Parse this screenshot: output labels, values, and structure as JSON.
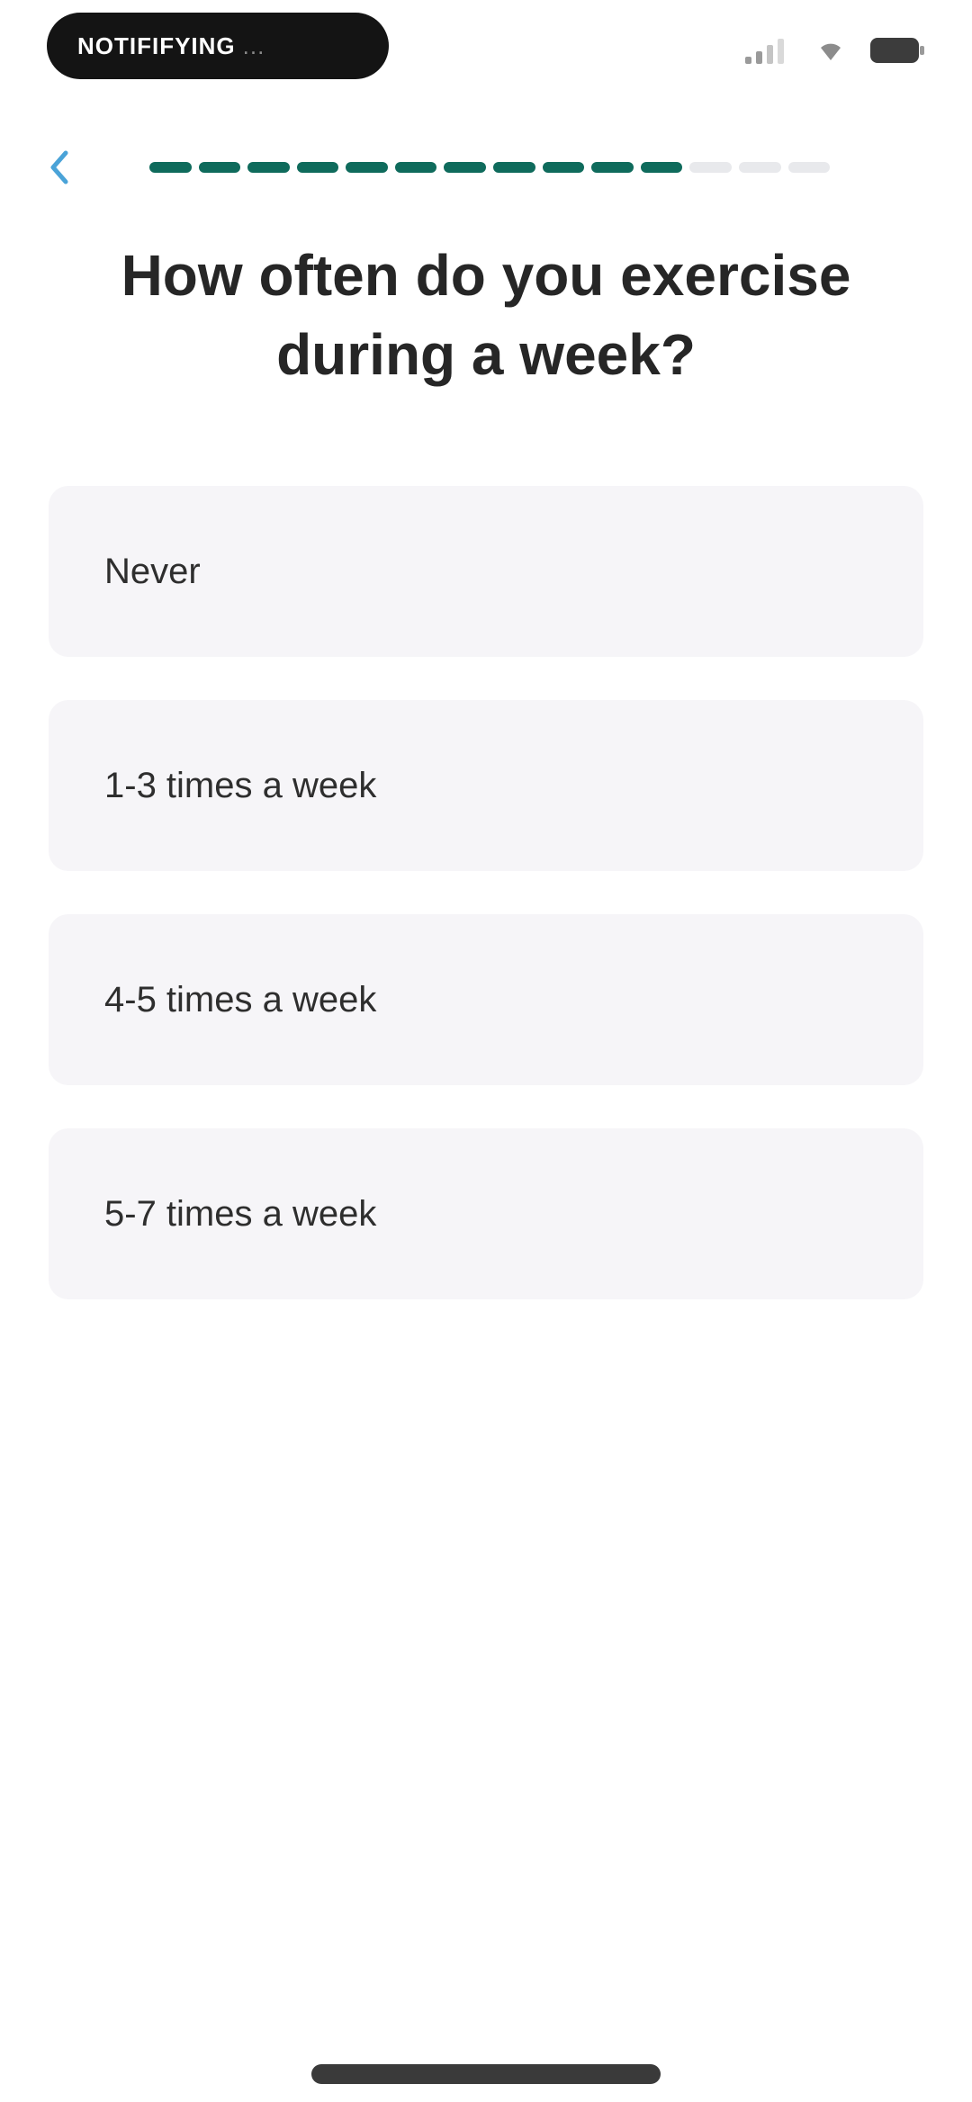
{
  "status_bar": {
    "pill_text_main": "NOTIFIFYING",
    "pill_text_dim": "...",
    "icons": [
      "signal-icon",
      "wifi-icon",
      "battery-icon"
    ]
  },
  "header": {
    "back_icon": "chevron-left-icon",
    "progress": {
      "completed_steps": 11,
      "total_steps": 14
    }
  },
  "question": {
    "title": "How often do you exercise during a week?"
  },
  "options": [
    {
      "label": "Never"
    },
    {
      "label": "1-3 times a week"
    },
    {
      "label": "4-5 times a week"
    },
    {
      "label": "5-7 times a week"
    }
  ],
  "colors": {
    "accent": "#0f6b5c",
    "progress_track": "#e8e9ec",
    "option_bg": "#f6f5f8",
    "back_icon": "#4aa3d8"
  }
}
